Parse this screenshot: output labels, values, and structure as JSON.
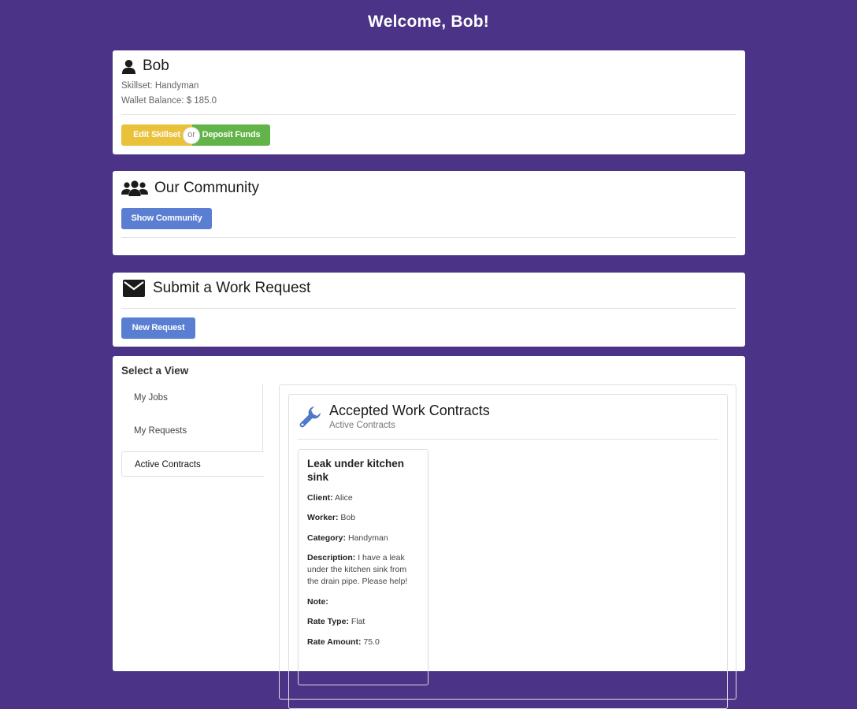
{
  "header": {
    "title": "Welcome, Bob!"
  },
  "profile": {
    "name": "Bob",
    "skillset_label": "Skillset:",
    "skillset_value": "Handyman",
    "wallet_label": "Wallet Balance:",
    "wallet_value": "$ 185.0",
    "edit_skillset_label": "Edit Skillset",
    "or_label": "or",
    "deposit_funds_label": "Deposit Funds",
    "icon": "user-icon"
  },
  "community": {
    "title": "Our Community",
    "show_button_label": "Show Community",
    "icon": "users-icon"
  },
  "work_request": {
    "title": "Submit a Work Request",
    "new_request_label": "New Request",
    "icon": "envelope-icon"
  },
  "views": {
    "label": "Select a View",
    "menu": [
      {
        "label": "My Jobs",
        "active": false
      },
      {
        "label": "My Requests",
        "active": false
      },
      {
        "label": "Active Contracts",
        "active": true
      }
    ]
  },
  "contracts": {
    "title": "Accepted Work Contracts",
    "subtitle": "Active Contracts",
    "icon": "wrench-icon",
    "job": {
      "title": "Leak under kitchen sink",
      "client_label": "Client:",
      "client": "Alice",
      "worker_label": "Worker:",
      "worker": "Bob",
      "category_label": "Category:",
      "category": "Handyman",
      "description_label": "Description:",
      "description": "I have a leak under the kitchen sink from the drain pipe. Please help!",
      "note_label": "Note:",
      "note": "",
      "rate_type_label": "Rate Type:",
      "rate_type": "Flat",
      "rate_amount_label": "Rate Amount:",
      "rate_amount": "75.0"
    }
  },
  "colors": {
    "background": "#4b3387",
    "primary_button": "#5a7fd2",
    "edit_button": "#e9c13a",
    "deposit_button": "#63b448",
    "wrench_icon": "#4f78c8"
  }
}
